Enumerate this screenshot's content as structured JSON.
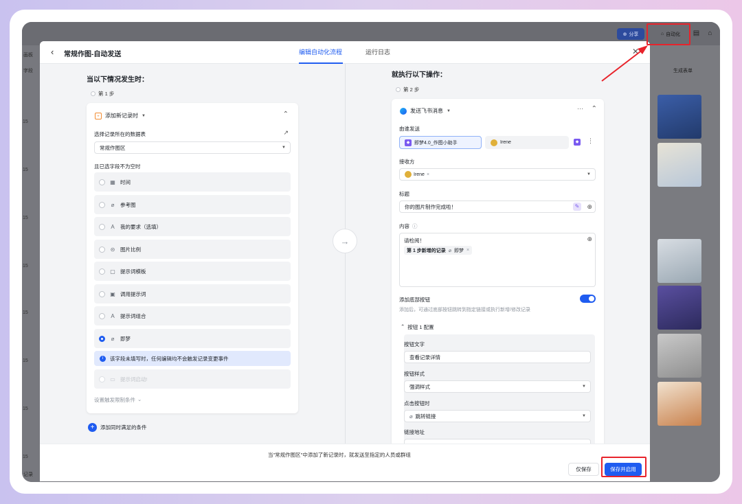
{
  "app": {
    "share_label": "分享",
    "automation_label": "自动化",
    "bg_left_labels": [
      "画板",
      "字段"
    ],
    "bg_right_labels": [
      "生成表单"
    ],
    "row_numbers": [
      "15",
      "15",
      "15",
      "15",
      "15",
      "15",
      "15",
      "15",
      "15"
    ],
    "bottom_left": "记录"
  },
  "modal": {
    "title": "常规作图-自动发送",
    "tabs": [
      {
        "label": "编辑自动化流程",
        "active": true
      },
      {
        "label": "运行日志",
        "active": false
      }
    ]
  },
  "trigger": {
    "heading": "当以下情况发生时：",
    "step_label": "第 1 步",
    "event_title": "添加新记录时",
    "table_label": "选择记录所在的数据表",
    "table_value": "常规作图区",
    "condition_label": "且已选字段不为空时",
    "fields": [
      {
        "label": "时间",
        "icon": "calendar-icon",
        "selected": false
      },
      {
        "label": "参考图",
        "icon": "attachment-icon",
        "selected": false
      },
      {
        "label": "我的要求（选填）",
        "icon": "text-icon",
        "selected": false
      },
      {
        "label": "图片比例",
        "icon": "circle-minus-icon",
        "selected": false
      },
      {
        "label": "提示词模板",
        "icon": "template-icon",
        "selected": false
      },
      {
        "label": "调用提示词",
        "icon": "lookup-icon",
        "selected": false
      },
      {
        "label": "提示词组合",
        "icon": "text-icon",
        "selected": false
      },
      {
        "label": "即梦",
        "icon": "attachment-icon",
        "selected": true
      }
    ],
    "notice": "该字段未填写时，任何编辑均不会触发记录变更事件",
    "disabled_field": "提示词启动!",
    "limit_link": "设置触发限制条件",
    "add_condition": "添加同时满足的条件"
  },
  "action": {
    "heading": "就执行以下操作：",
    "step_label": "第 2 步",
    "action_title": "发送飞书消息",
    "sender_label": "由谁发送",
    "sender_bot": "即梦4.0_作图小助手",
    "sender_user": "Irene",
    "receiver_label": "接收方",
    "receiver_chip": "Irene",
    "title_label": "标题",
    "title_value": "你的图片制作完成啦！",
    "content_label": "内容",
    "content_text": "请检阅！",
    "content_chip_step": "第 1 步新增的记录",
    "content_chip_field": "即梦",
    "bottom_btn_label": "添加底部按钮",
    "bottom_btn_desc": "添加后，可通过底部按钮跳转到指定链接或执行新增/修改记录",
    "bottom_btn_enabled": true,
    "button_config_title": "按钮 1 配置",
    "btn_text_label": "按钮文字",
    "btn_text_value": "查看记录详情",
    "btn_style_label": "按钮样式",
    "btn_style_value": "强调样式",
    "btn_click_label": "点击按钮时",
    "btn_click_value": "跳转链接",
    "link_label": "链接地址"
  },
  "footer": {
    "summary": "当\"常规作图区\"中添加了新记录时，就发送至指定的人员或群组",
    "save_only": "仅保存",
    "save_enable": "保存并启用"
  },
  "colors": {
    "accent": "#1f5cf0",
    "highlight": "#e8232b"
  }
}
